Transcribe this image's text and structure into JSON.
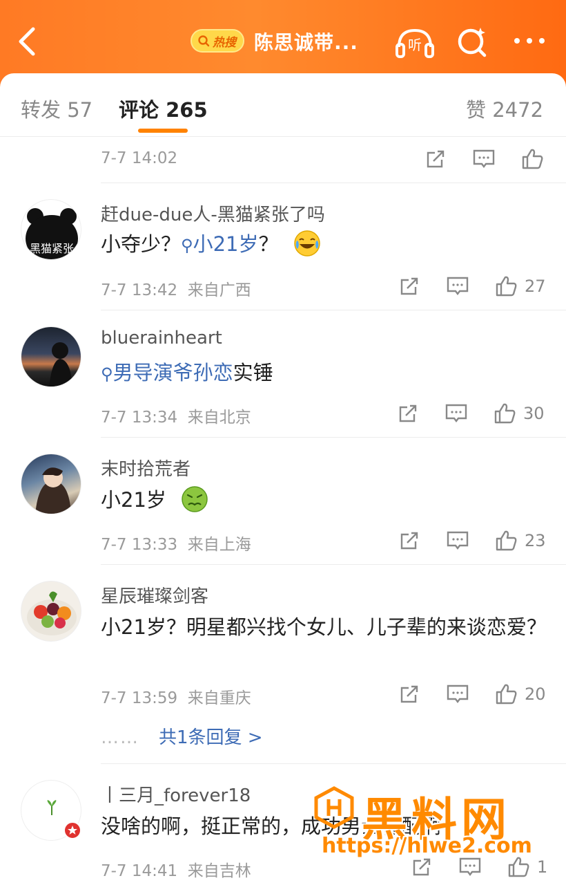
{
  "header": {
    "hot_badge": "热搜",
    "title": "陈思诚带...",
    "listen_label": "听"
  },
  "tabs": {
    "repost": "转发 57",
    "comments": "评论 265",
    "likes": "赞 2472"
  },
  "comments": [
    {
      "time": "7-7 14:02",
      "location": "",
      "likes": ""
    },
    {
      "user": "赶due-due人-黑猫紧张了吗",
      "text_before": "小夺少？",
      "topic_link": "小21岁",
      "text_after": "？",
      "emoji": "laughing-crying",
      "time": "7-7 13:42",
      "location": "来自广西",
      "likes": "27",
      "avatar_caption": "黑猫紧张"
    },
    {
      "user": "bluerainheart",
      "topic_link": "男导演爷孙恋",
      "text_after": "实锤",
      "time": "7-7 13:34",
      "location": "来自北京",
      "likes": "30"
    },
    {
      "user": "末时拾荒者",
      "text": "小21岁",
      "emoji": "nauseated",
      "time": "7-7 13:33",
      "location": "来自上海",
      "likes": "23"
    },
    {
      "user": "星辰璀璨剑客",
      "text": "小21岁？明星都兴找个女儿、儿子辈的来谈恋爱？",
      "time": "7-7 13:59",
      "location": "来自重庆",
      "likes": "20",
      "reply_dots": "……",
      "reply_link": "共1条回复 >"
    },
    {
      "user": "丨三月_forever18",
      "text": "没啥的啊，挺正常的，成功男士标配啊",
      "time": "7-7 14:41",
      "location": "来自吉林",
      "likes": "1"
    }
  ],
  "watermark": {
    "title": "黑料网",
    "url": "https://hlwe2.com"
  },
  "colors": {
    "brand_orange": "#ff8200",
    "link_blue": "#3d6bb5",
    "header_gradient_start": "#ff7a24",
    "header_gradient_end": "#ff6a12"
  }
}
